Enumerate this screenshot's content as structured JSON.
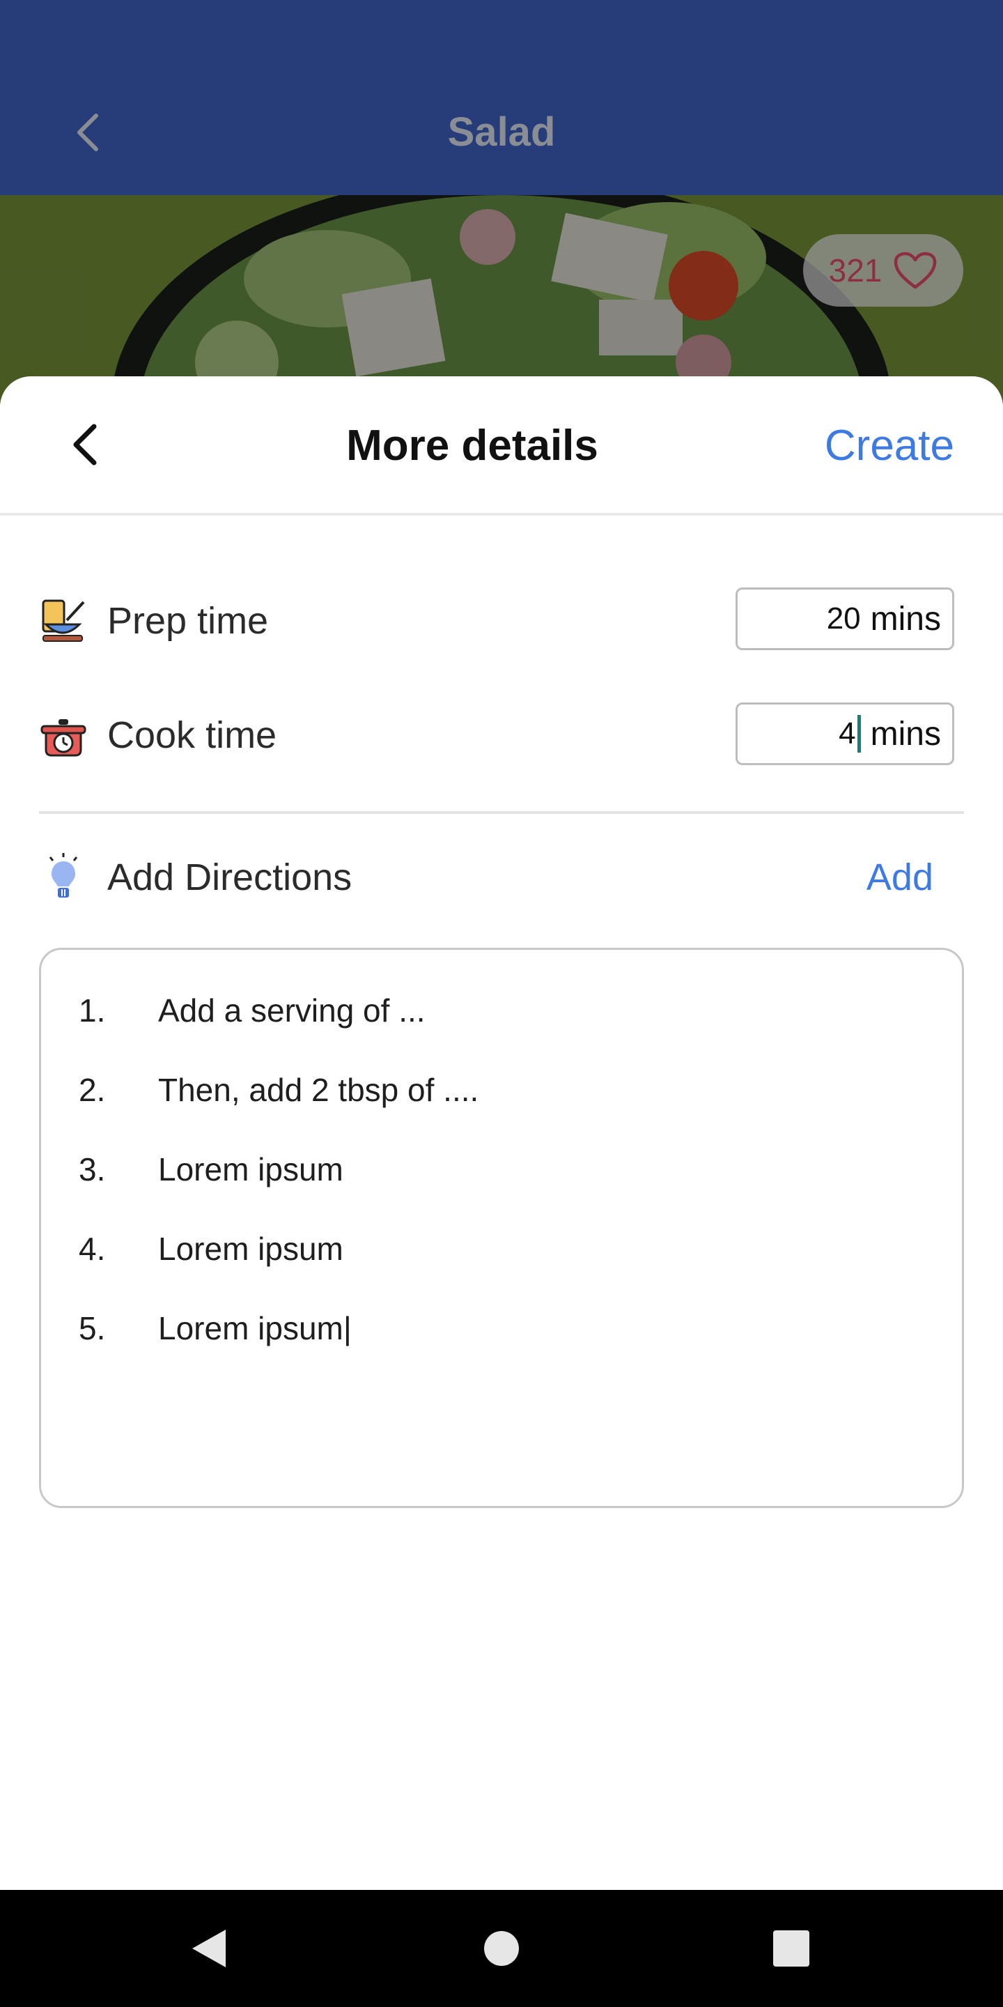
{
  "app_bar": {
    "title": "Salad",
    "back_icon": "chevron-left-icon"
  },
  "hero": {
    "likes": "321",
    "like_icon": "heart-icon"
  },
  "sheet": {
    "title": "More details",
    "create_label": "Create",
    "back_icon": "chevron-left-icon"
  },
  "prep": {
    "label": "Prep time",
    "value": "20",
    "unit": "mins",
    "icon": "prep-bowl-icon"
  },
  "cook": {
    "label": "Cook time",
    "value": "4",
    "unit": "mins",
    "icon": "cooking-pot-timer-icon"
  },
  "directions": {
    "label": "Add Directions",
    "add_label": "Add",
    "icon": "lightbulb-icon",
    "steps": [
      {
        "num": "1.",
        "text": "Add a serving of ..."
      },
      {
        "num": "2.",
        "text": "Then, add 2 tbsp of ...."
      },
      {
        "num": "3.",
        "text": "Lorem ipsum"
      },
      {
        "num": "4.",
        "text": "Lorem ipsum"
      },
      {
        "num": "5.",
        "text": "Lorem ipsum|"
      }
    ]
  },
  "nav": {
    "back_icon": "nav-back-icon",
    "home_icon": "nav-home-icon",
    "recents_icon": "nav-recents-icon"
  },
  "colors": {
    "accent": "#3d7be3",
    "app_bar": "#263d7a",
    "cursor": "#15807a"
  }
}
